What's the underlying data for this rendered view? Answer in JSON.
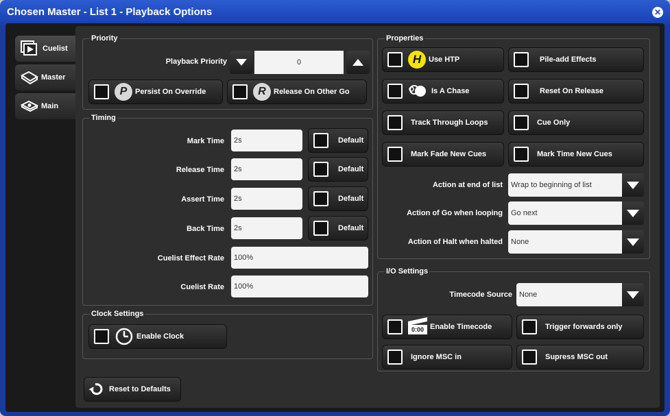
{
  "window": {
    "title": "Chosen Master - List 1 - Playback Options"
  },
  "tabs": [
    {
      "label": "Cuelist"
    },
    {
      "label": "Master"
    },
    {
      "label": "Main"
    }
  ],
  "priority": {
    "group_label": "Priority",
    "playback_priority_label": "Playback Priority",
    "playback_priority_value": "0",
    "persist_on_override": "Persist On Override",
    "release_on_other_go": "Release On Other Go"
  },
  "timing": {
    "group_label": "Timing",
    "mark_time_label": "Mark Time",
    "mark_time_value": "2s",
    "release_time_label": "Release Time",
    "release_time_value": "2s",
    "assert_time_label": "Assert Time",
    "assert_time_value": "2s",
    "back_time_label": "Back Time",
    "back_time_value": "2s",
    "default_label": "Default",
    "cuelist_effect_rate_label": "Cuelist Effect Rate",
    "cuelist_effect_rate_value": "100%",
    "cuelist_rate_label": "Cuelist Rate",
    "cuelist_rate_value": "100%"
  },
  "clock": {
    "group_label": "Clock Settings",
    "enable_clock": "Enable Clock"
  },
  "reset": {
    "label": "Reset to Defaults"
  },
  "properties": {
    "group_label": "Properties",
    "use_htp": "Use HTP",
    "pile_add_effects": "Pile-add Effects",
    "is_a_chase": "Is A Chase",
    "reset_on_release": "Reset On Release",
    "track_through_loops": "Track Through Loops",
    "cue_only": "Cue Only",
    "mark_fade_new_cues": "Mark Fade New Cues",
    "mark_time_new_cues": "Mark Time New Cues",
    "action_end_label": "Action at end of list",
    "action_end_value": "Wrap to beginning of list",
    "action_go_label": "Action of Go when looping",
    "action_go_value": "Go next",
    "action_halt_label": "Action of Halt when halted",
    "action_halt_value": "None"
  },
  "io": {
    "group_label": "I/O Settings",
    "timecode_source_label": "Timecode Source",
    "timecode_source_value": "None",
    "enable_timecode": "Enable Timecode",
    "timecode_icon_text": "0:00",
    "trigger_forwards_only": "Trigger forwards only",
    "ignore_msc_in": "Ignore MSC in",
    "supress_msc_out": "Supress MSC out"
  },
  "icons": {
    "htp_letter": "H",
    "persist_letter": "P",
    "release_letter": "R"
  }
}
